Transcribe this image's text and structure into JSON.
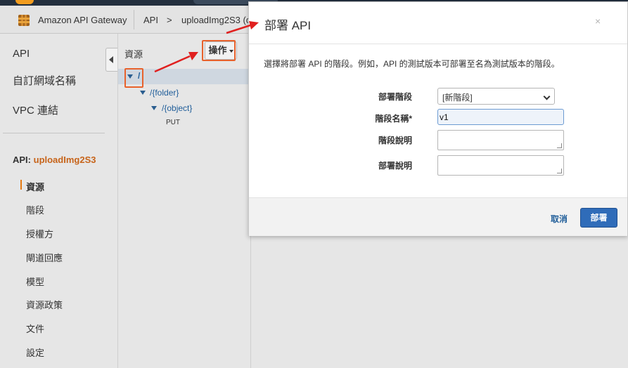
{
  "colors": {
    "accent_orange": "#e47911",
    "api_name_orange": "#c7641a",
    "link_blue": "#1f5d99",
    "primary_button": "#2f6cb9",
    "annotation_red": "#e0201f",
    "highlight_border": "#e8622c"
  },
  "breadcrumb": {
    "service": "Amazon API Gateway",
    "section": "API",
    "separator": ">",
    "api": "uploadImg2S3 (c"
  },
  "nav": {
    "api_link": "API",
    "custom_domains": "自訂網域名稱",
    "vpc_links": "VPC 連結",
    "api_prefix": "API:",
    "api_name": "uploadImg2S3",
    "sub_items": [
      {
        "label": "資源",
        "active": true
      },
      {
        "label": "階段",
        "active": false
      },
      {
        "label": "授權方",
        "active": false
      },
      {
        "label": "閘道回應",
        "active": false
      },
      {
        "label": "模型",
        "active": false
      },
      {
        "label": "資源政策",
        "active": false
      },
      {
        "label": "文件",
        "active": false
      },
      {
        "label": "設定",
        "active": false
      }
    ]
  },
  "resources": {
    "title": "資源",
    "actions_label": "操作",
    "tree": {
      "root": "/",
      "folder": "/{folder}",
      "object": "/{object}",
      "method": "PUT"
    }
  },
  "modal": {
    "title": "部署 API",
    "close": "×",
    "description": "選擇將部署 API 的階段。例如，API 的測試版本可部署至名為測試版本的階段。",
    "deploy_stage_label": "部署階段",
    "deploy_stage_value": "[新階段]",
    "stage_name_label": "階段名稱*",
    "stage_name_value": "v1",
    "stage_desc_label": "階段說明",
    "deploy_desc_label": "部署說明",
    "cancel": "取消",
    "deploy": "部署"
  }
}
